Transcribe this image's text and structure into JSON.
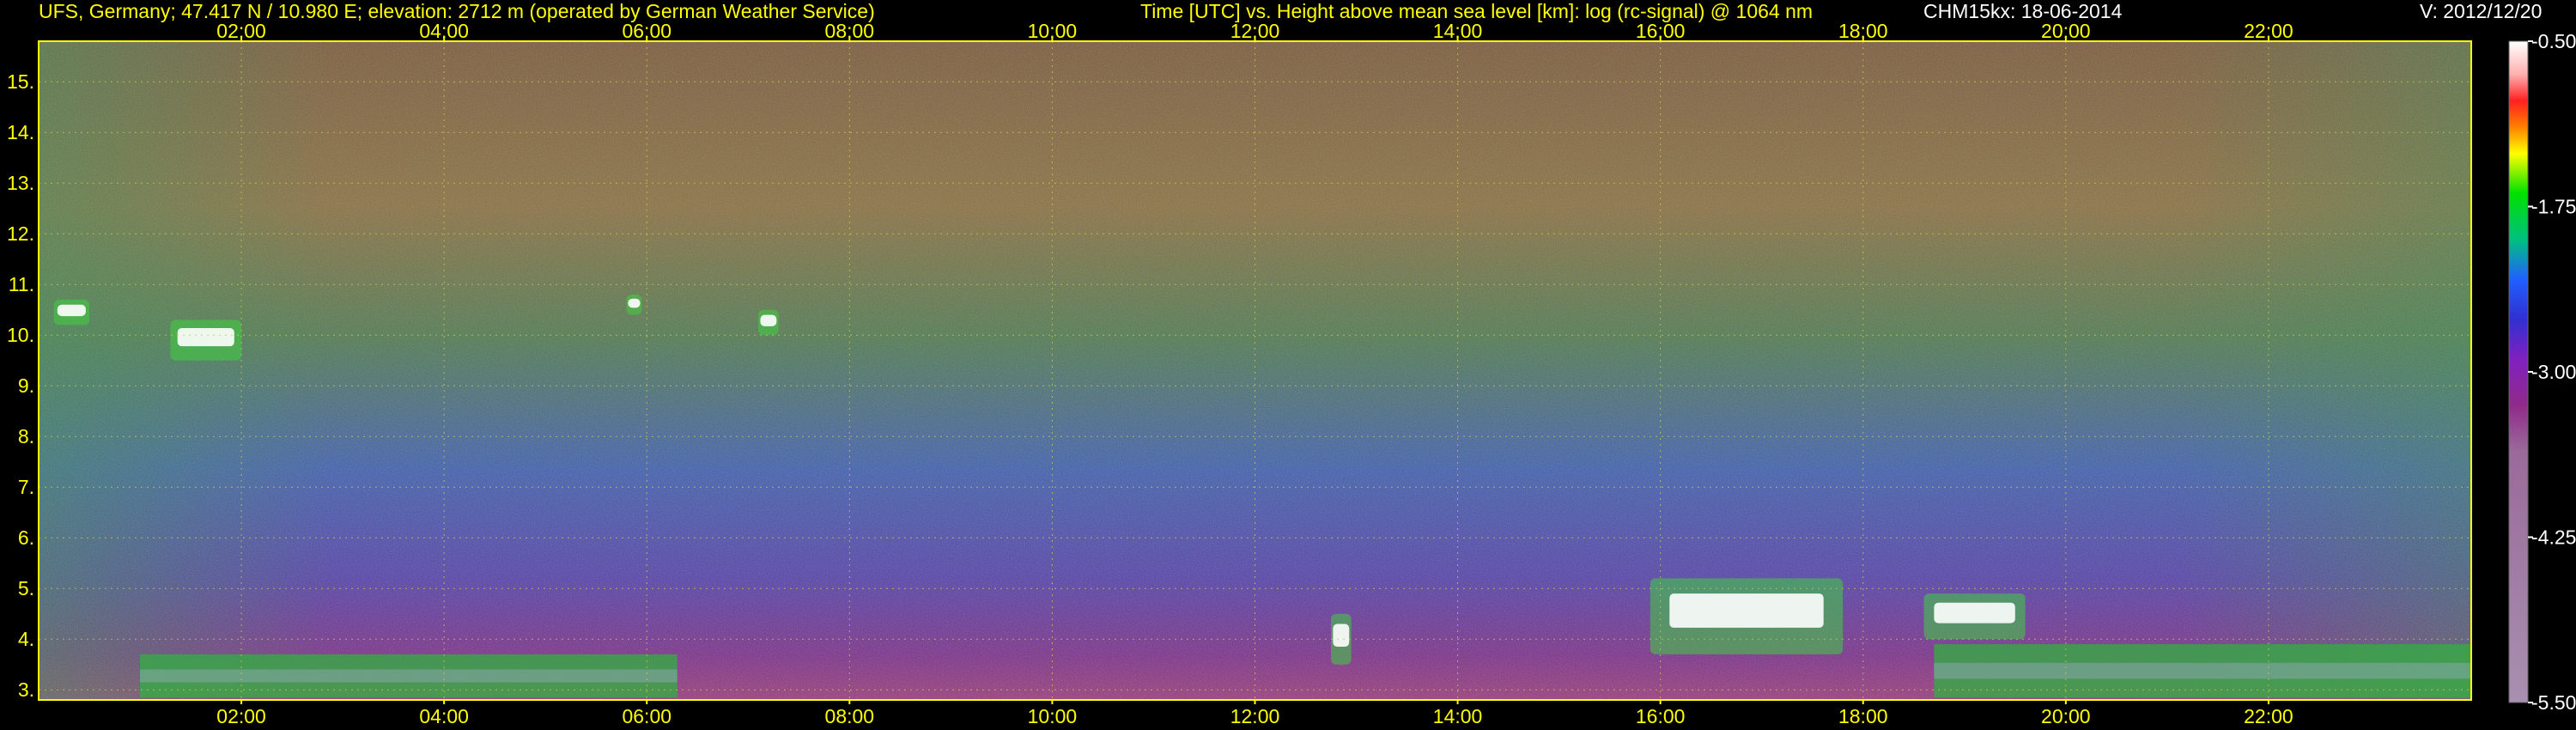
{
  "header": {
    "station": "UFS, Germany; 47.417 N / 10.980 E; elevation: 2712 m  (operated by German Weather Service)",
    "title": "Time [UTC] vs. Height above mean sea level [km]: log (rc-signal) @ 1064 nm",
    "instrument": "CHM15kx: 18-06-2014",
    "version": "V: 2012/12/20"
  },
  "colors": {
    "text_yellow": "#ffff00",
    "text_white": "#ffffff",
    "grid": "#c8c850",
    "background": "#000000"
  },
  "chart_data": {
    "type": "heatmap",
    "title": "Time [UTC] vs. Height above mean sea level [km]: log (rc-signal) @ 1064 nm",
    "xlabel": "Time [UTC]",
    "ylabel": "Height above mean sea level [km]",
    "x_unit": "hours UTC",
    "xlim": [
      0,
      24
    ],
    "ylim": [
      2.8,
      15.8
    ],
    "x_ticks": [
      2,
      4,
      6,
      8,
      10,
      12,
      14,
      16,
      18,
      20,
      22
    ],
    "x_tick_labels": [
      "02:00",
      "04:00",
      "06:00",
      "08:00",
      "10:00",
      "12:00",
      "14:00",
      "16:00",
      "18:00",
      "20:00",
      "22:00"
    ],
    "y_ticks": [
      3,
      4,
      5,
      6,
      7,
      8,
      9,
      10,
      11,
      12,
      13,
      14,
      15
    ],
    "y_tick_labels": [
      "3.",
      "4.",
      "5.",
      "6.",
      "7.",
      "8.",
      "9.",
      "10.",
      "11.",
      "12.",
      "13.",
      "14.",
      "15."
    ],
    "grid": true,
    "colorbar": {
      "ticks": [
        -0.5,
        -1.75,
        -3.0,
        -4.25,
        -5.5
      ],
      "tick_labels": [
        "-0.50",
        "-1.75",
        "-3.00",
        "-4.25",
        "-5.50"
      ],
      "range": [
        -5.5,
        -0.5
      ]
    },
    "features": [
      {
        "kind": "cloud",
        "t_start": 0.15,
        "t_end": 0.5,
        "h_start": 10.2,
        "h_end": 10.7
      },
      {
        "kind": "cloud",
        "t_start": 1.3,
        "t_end": 2.0,
        "h_start": 9.5,
        "h_end": 10.3
      },
      {
        "kind": "cloud",
        "t_start": 5.8,
        "t_end": 5.95,
        "h_start": 10.4,
        "h_end": 10.8
      },
      {
        "kind": "cloud",
        "t_start": 7.1,
        "t_end": 7.3,
        "h_start": 10.0,
        "h_end": 10.5
      },
      {
        "kind": "cloud",
        "t_start": 15.9,
        "t_end": 17.8,
        "h_start": 3.7,
        "h_end": 5.2
      },
      {
        "kind": "cloud",
        "t_start": 18.6,
        "t_end": 19.6,
        "h_start": 4.0,
        "h_end": 4.9
      },
      {
        "kind": "cloud",
        "t_start": 12.75,
        "t_end": 12.95,
        "h_start": 3.5,
        "h_end": 4.5
      },
      {
        "kind": "boundary_layer",
        "t_start": 1.0,
        "t_end": 6.3,
        "h_start": 2.85,
        "h_end": 3.7
      },
      {
        "kind": "boundary_layer",
        "t_start": 18.7,
        "t_end": 24.0,
        "h_start": 2.85,
        "h_end": 3.9
      }
    ]
  }
}
